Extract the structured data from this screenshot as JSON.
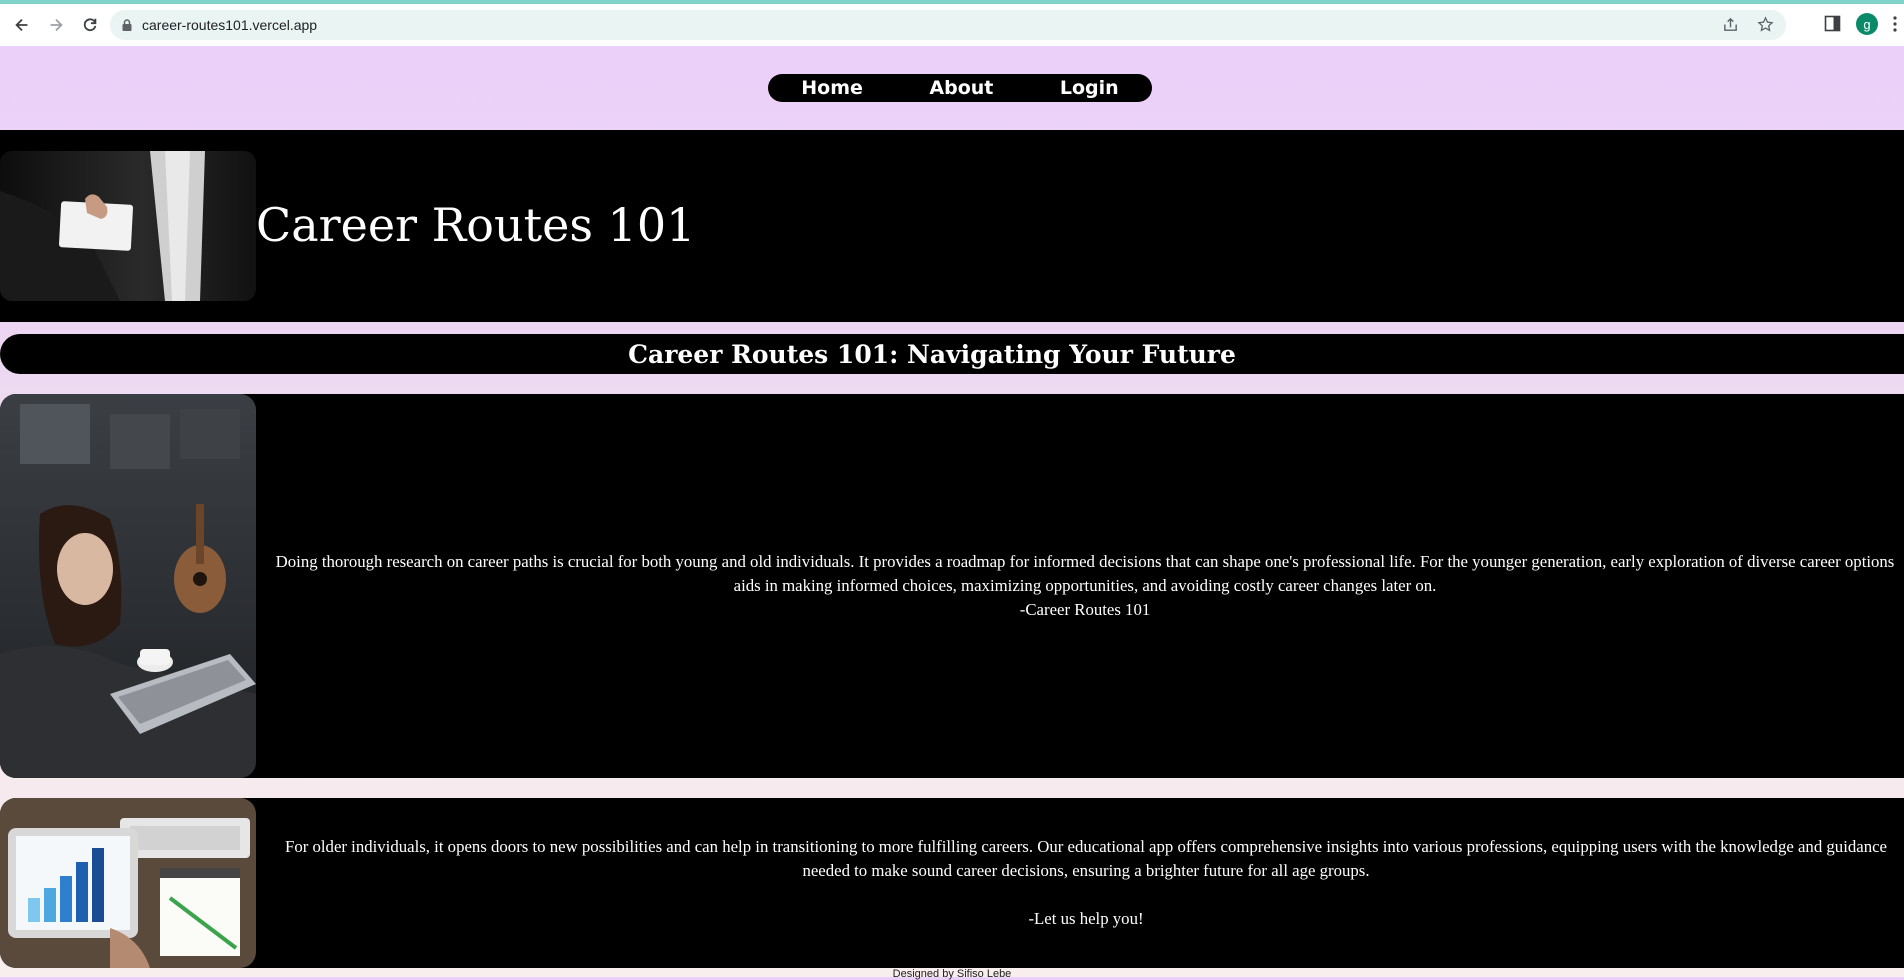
{
  "browser": {
    "url": "career-routes101.vercel.app",
    "avatar_letter": "g"
  },
  "nav": {
    "items": [
      "Home",
      "About",
      "Login"
    ]
  },
  "hero": {
    "title": "Career Routes 101"
  },
  "banner": {
    "title": "Career Routes 101: Navigating Your Future"
  },
  "section1": {
    "text": "Doing thorough research on career paths is crucial for both young and old individuals. It provides a roadmap for informed decisions that can shape one's professional life. For the younger generation, early exploration of diverse career options aids in making informed choices, maximizing opportunities, and avoiding costly career changes later on.",
    "signature": "-Career Routes 101"
  },
  "section2": {
    "text": "For older individuals, it opens doors to new possibilities and can help in transitioning to more fulfilling careers. Our educational app offers comprehensive insights into various professions, equipping users with the knowledge and guidance needed to make sound career decisions, ensuring a brighter future for all age groups.",
    "signature": "-Let us help you!"
  },
  "footer": {
    "text": "Designed by Sifiso Lebe"
  }
}
